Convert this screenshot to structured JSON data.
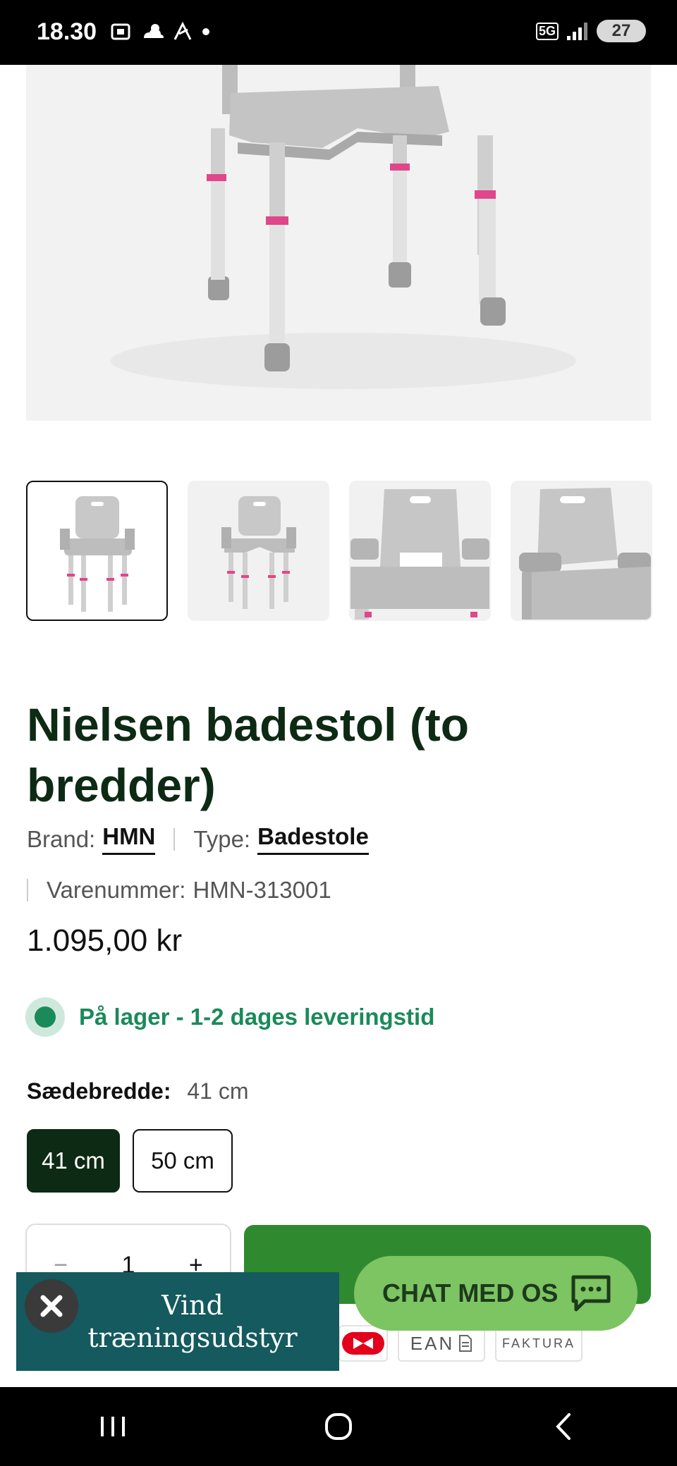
{
  "status_bar": {
    "time": "18.30",
    "network": "5G",
    "battery": "27"
  },
  "product": {
    "title": "Nielsen badestol (to bredder)",
    "brand_label": "Brand:",
    "brand_value": "HMN",
    "type_label": "Type:",
    "type_value": "Badestole",
    "sku_label": "Varenummer:",
    "sku_value": "HMN-313001",
    "price": "1.095,00 kr",
    "stock_text": "På lager - 1-2 dages leveringstid",
    "option_label": "Sædebredde:",
    "option_value": "41 cm",
    "options": [
      "41 cm",
      "50 cm"
    ],
    "quantity": "1",
    "qty_minus": "−",
    "qty_plus": "+"
  },
  "payments": {
    "ean": "EAN",
    "faktura": "FAKTURA"
  },
  "promo": {
    "text": "Vind træningsudstyr"
  },
  "chat": {
    "label": "CHAT MED OS"
  },
  "colors": {
    "title": "#0d2a14",
    "stock": "#1a8a5a",
    "selected_option": "#0d2a14",
    "add_to_cart": "#2f8a2f",
    "promo_bg": "#145a5e",
    "chat_bg": "#7dc462"
  }
}
